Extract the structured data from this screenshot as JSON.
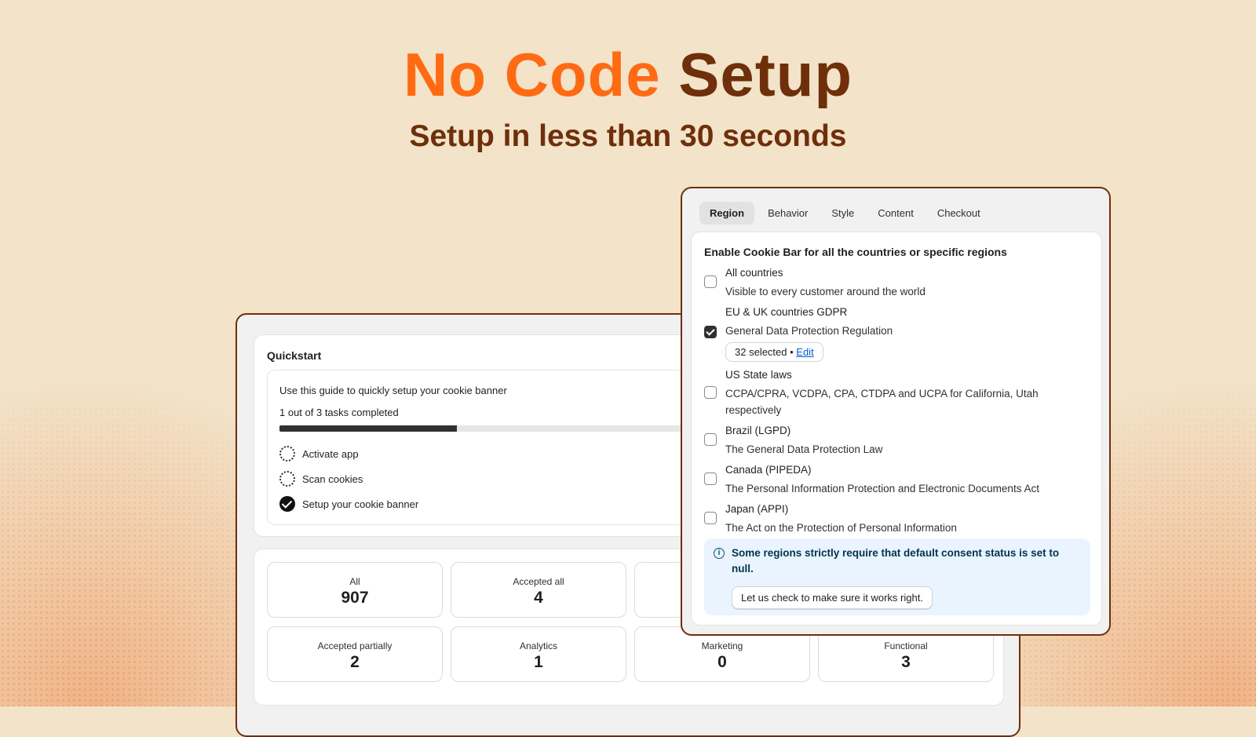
{
  "hero": {
    "title_part1": "No Code",
    "title_part2": "Setup",
    "subtitle": "Setup in less than 30 seconds"
  },
  "quickstart": {
    "title": "Quickstart",
    "guide_text": "Use this guide to quickly setup your cookie banner",
    "progress_text": "1 out of 3 tasks completed",
    "progress_fraction": 0.333,
    "tasks": [
      {
        "label": "Activate app",
        "done": false
      },
      {
        "label": "Scan cookies",
        "done": false
      },
      {
        "label": "Setup your cookie banner",
        "done": true
      }
    ]
  },
  "stats": [
    {
      "label": "All",
      "value": "907"
    },
    {
      "label": "Accepted all",
      "value": "4"
    },
    {
      "label": "Accepted partially",
      "value": "2"
    },
    {
      "label": "Analytics",
      "value": "1"
    },
    {
      "label": "Marketing",
      "value": "0"
    },
    {
      "label": "Functional",
      "value": "3"
    }
  ],
  "settings": {
    "tabs": [
      "Region",
      "Behavior",
      "Style",
      "Content",
      "Checkout"
    ],
    "active_tab": "Region",
    "heading": "Enable Cookie Bar for all the countries or specific regions",
    "options": [
      {
        "title": "All countries",
        "desc": "Visible to every customer around the world",
        "checked": false
      },
      {
        "title": "EU & UK countries GDPR",
        "desc": "General Data Protection Regulation",
        "checked": true,
        "selected_text": "32 selected",
        "selected_sep": " • ",
        "edit_label": "Edit"
      },
      {
        "title": "US State laws",
        "desc": "CCPA/CPRA, VCDPA, CPA, CTDPA and UCPA for California, Utah respectively",
        "checked": false
      },
      {
        "title": "Brazil (LGPD)",
        "desc": "The General Data Protection Law",
        "checked": false
      },
      {
        "title": "Canada (PIPEDA)",
        "desc": "The Personal Information Protection and Electronic Documents Act",
        "checked": false
      },
      {
        "title": "Japan (APPI)",
        "desc": "The Act on the Protection of Personal Information",
        "checked": false
      }
    ],
    "banner_text": "Some regions strictly require that default consent status is set to null.",
    "banner_button": "Let us check to make sure it works right."
  },
  "colors": {
    "accent_orange": "#ff6a13",
    "brand_brown": "#6e2f0a",
    "background": "#f2e3c9",
    "info_bg": "#eaf4ff"
  }
}
